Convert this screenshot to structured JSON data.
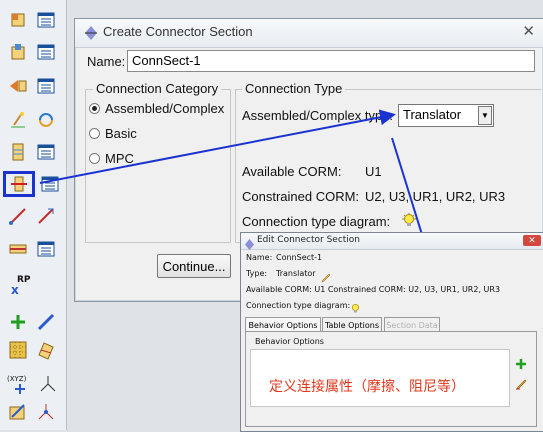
{
  "toolbar": {
    "buttons": [
      {
        "name": "create-part-icon"
      },
      {
        "name": "part-manager-icon"
      },
      {
        "name": "create-material-icon"
      },
      {
        "name": "material-manager-icon"
      },
      {
        "name": "create-assembly-icon"
      },
      {
        "name": "assembly-manager-icon"
      },
      {
        "name": "create-step-icon"
      },
      {
        "name": "step-manager-icon"
      },
      {
        "name": "create-interaction-icon"
      },
      {
        "name": "interaction-manager-icon"
      },
      {
        "name": "create-connector-section-icon"
      },
      {
        "name": "connector-section-manager-icon"
      },
      {
        "name": "create-wire-icon"
      },
      {
        "name": "create-wire-feature-icon"
      },
      {
        "name": "create-constraint-icon"
      },
      {
        "name": "constraint-manager-icon"
      },
      {
        "name": "create-reference-point-icon"
      },
      {
        "name": "create-datum-icon"
      },
      {
        "name": "create-edge-icon"
      },
      {
        "name": "create-mesh-icon"
      },
      {
        "name": "create-partition-icon"
      },
      {
        "name": "create-coordinate-system-icon"
      },
      {
        "name": "create-axis-icon"
      },
      {
        "name": "create-csys-icon"
      },
      {
        "name": "create-orientation-icon"
      }
    ],
    "rp_label": "RP",
    "xyz_label": "(XYZ)"
  },
  "create_dialog": {
    "title": "Create Connector Section",
    "close_glyph": "✕",
    "name_label": "Name:",
    "name_value": "ConnSect-1",
    "category_title": "Connection Category",
    "categories": [
      {
        "label": "Assembled/Complex",
        "selected": true
      },
      {
        "label": "Basic",
        "selected": false
      },
      {
        "label": "MPC",
        "selected": false
      }
    ],
    "type_title": "Connection Type",
    "type_label": "Assembled/Complex type:",
    "type_value": "Translator",
    "available_label": "Available CORM:",
    "available_value": "U1",
    "constrained_label": "Constrained CORM:",
    "constrained_value": "U2, U3, UR1, UR2, UR3",
    "diagram_label": "Connection type diagram:",
    "continue_label": "Continue..."
  },
  "edit_dialog": {
    "title": "Edit Connector Section",
    "close_glyph": "✕",
    "name_label": "Name:",
    "name_value": "ConnSect-1",
    "type_label": "Type:",
    "type_value": "Translator",
    "corm_line": "Available CORM:  U1  Constrained CORM:  U2, U3, UR1, UR2, UR3",
    "diagram_label": "Connection type diagram:",
    "tabs": [
      {
        "label": "Behavior Options",
        "active": true,
        "enabled": true
      },
      {
        "label": "Table Options",
        "active": false,
        "enabled": true
      },
      {
        "label": "Section Data",
        "active": false,
        "enabled": false
      }
    ],
    "behavior_title": "Behavior Options",
    "annotation": "定义连接属性（摩擦、阻尼等）"
  },
  "colors": {
    "highlight": "#1b33d0",
    "arrow": "#1b33d0",
    "annotation": "#e0381c"
  }
}
